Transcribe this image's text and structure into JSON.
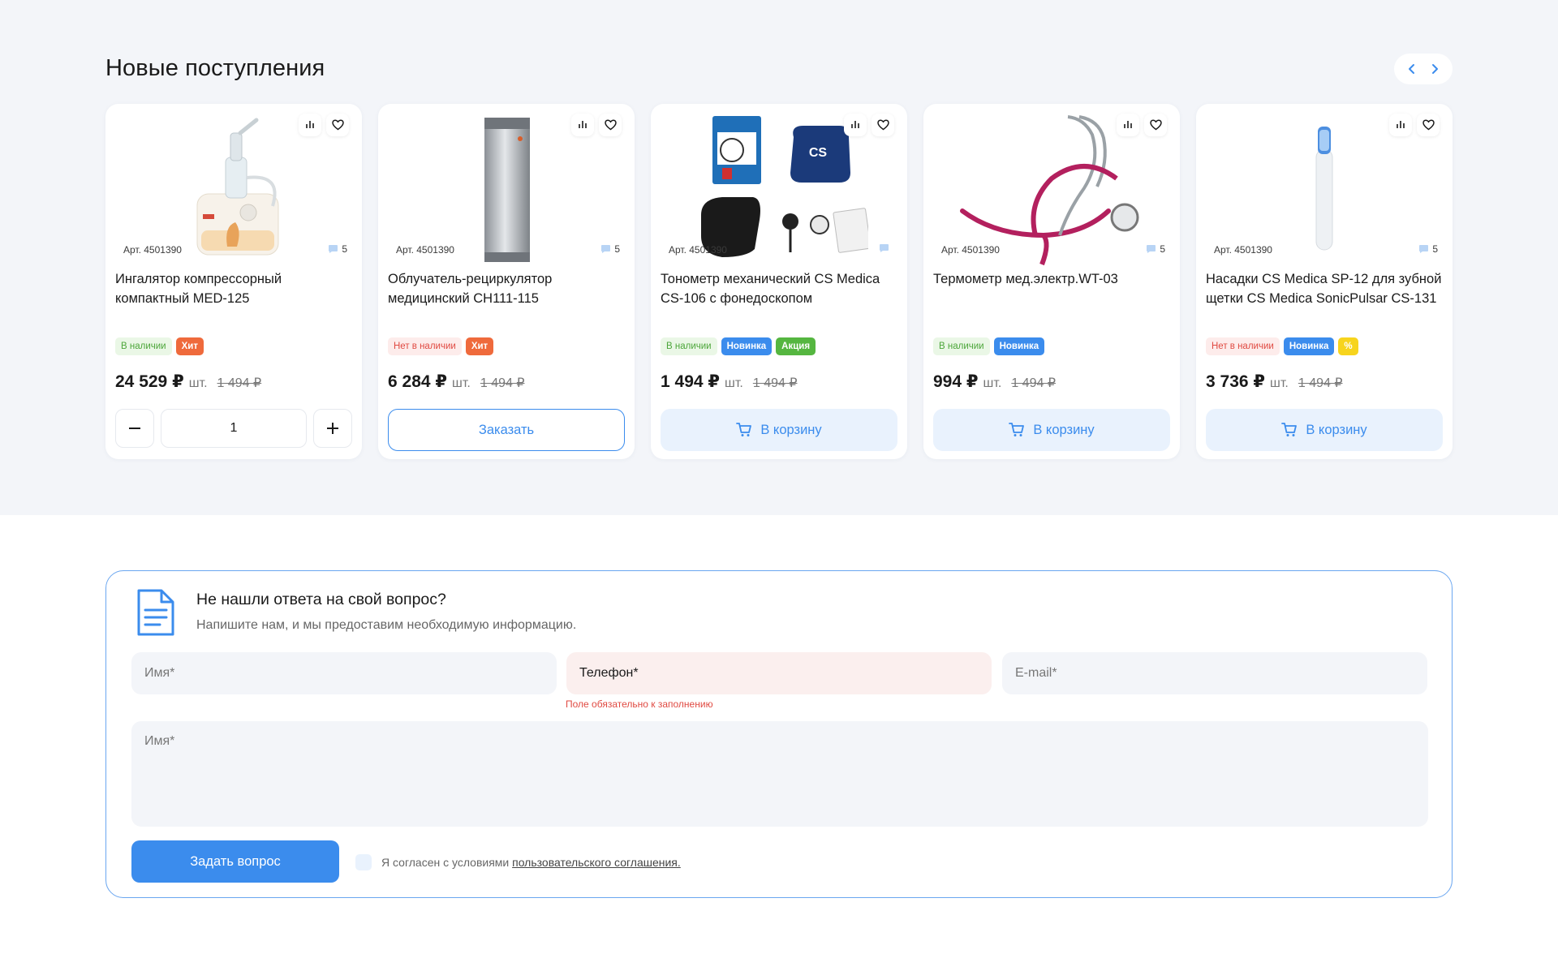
{
  "section": {
    "title": "Новые поступления"
  },
  "colors": {
    "accent": "#3b8ced",
    "error": "#e04a42",
    "background": "#f3f5f9"
  },
  "products": [
    {
      "art": "Арт. 4501390",
      "reviews": "5",
      "name": "Ингалятор компрессорный компактный MED-125",
      "badges": [
        {
          "type": "instock",
          "label": "В наличии"
        },
        {
          "type": "hit",
          "label": "Хит"
        }
      ],
      "price": "24 529 ₽",
      "unit": "шт.",
      "old_price": "1 494 ₽",
      "action": "qty",
      "qty": "1",
      "image": "nebulizer"
    },
    {
      "art": "Арт. 4501390",
      "reviews": "5",
      "name": "Облучатель-рециркулятор медицинский СН111-115",
      "badges": [
        {
          "type": "outstock",
          "label": "Нет в наличии"
        },
        {
          "type": "hit",
          "label": "Хит"
        }
      ],
      "price": "6 284 ₽",
      "unit": "шт.",
      "old_price": "1 494 ₽",
      "action": "order",
      "action_label": "Заказать",
      "image": "recirculator"
    },
    {
      "art": "Арт. 4501390",
      "reviews": "",
      "name": "Тонометр механический CS Medica CS-106 с фонедоскопом",
      "badges": [
        {
          "type": "instock",
          "label": "В наличии"
        },
        {
          "type": "new",
          "label": "Новинка"
        },
        {
          "type": "sale",
          "label": "Акция"
        }
      ],
      "price": "1 494 ₽",
      "unit": "шт.",
      "old_price": "1 494 ₽",
      "action": "cart",
      "action_label": "В корзину",
      "image": "tonometer"
    },
    {
      "art": "Арт. 4501390",
      "reviews": "5",
      "name": "Термометр мед.электр.WT-03",
      "badges": [
        {
          "type": "instock",
          "label": "В наличии"
        },
        {
          "type": "new",
          "label": "Новинка"
        }
      ],
      "price": "994 ₽",
      "unit": "шт.",
      "old_price": "1 494 ₽",
      "action": "cart",
      "action_label": "В корзину",
      "image": "stethoscope"
    },
    {
      "art": "Арт. 4501390",
      "reviews": "5",
      "name": "Насадки CS Medica SP-12 для зубной щетки CS Medica SonicPulsar CS-131",
      "badges": [
        {
          "type": "outstock",
          "label": "Нет в наличии"
        },
        {
          "type": "new",
          "label": "Новинка"
        },
        {
          "type": "pct",
          "label": "%"
        }
      ],
      "price": "3 736 ₽",
      "unit": "шт.",
      "old_price": "1 494 ₽",
      "action": "cart",
      "action_label": "В корзину",
      "image": "toothbrush"
    }
  ],
  "form": {
    "title": "Не нашли ответа на свой вопрос?",
    "subtitle": "Напишите нам, и мы предоставим необходимую информацию.",
    "name_placeholder": "Имя*",
    "phone_label": "Телефон*",
    "email_placeholder": "E-mail*",
    "phone_error": "Поле обязательно к заполнению",
    "message_placeholder": "Имя*",
    "submit_label": "Задать вопрос",
    "agree_text": "Я согласен с условиями ",
    "agree_link": "пользовательского соглашения."
  }
}
